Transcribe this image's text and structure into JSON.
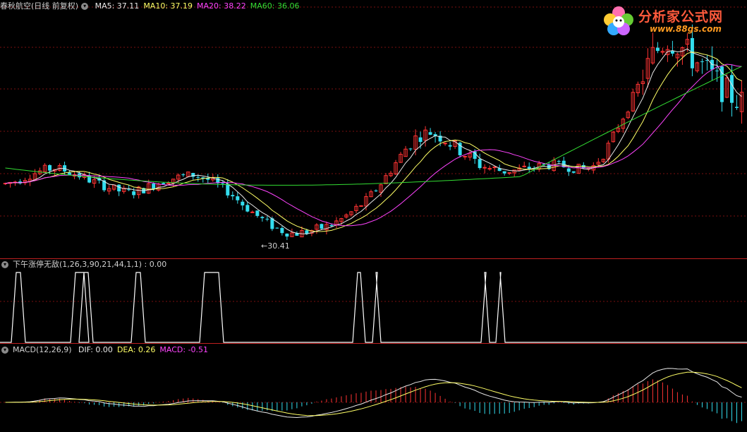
{
  "main_header": {
    "name": "春秋航空(日线 前复权)",
    "indicators": [
      {
        "text": "MA5: 37.11",
        "color": "#e8e8e8"
      },
      {
        "text": "MA10: 37.19",
        "color": "#ffff66"
      },
      {
        "text": "MA20: 38.22",
        "color": "#ff44ff"
      },
      {
        "text": "MA60: 36.06",
        "color": "#33dd33"
      }
    ]
  },
  "low_label": "←30.41",
  "indicator_header": {
    "text": "下午涨停无敌(1,26,3,90,21,44,1,1) : 0.00"
  },
  "macd_header": {
    "name": "MACD(12,26,9)",
    "values": [
      {
        "text": "DIF: 0.00",
        "color": "#e8e8e8"
      },
      {
        "text": "DEA: 0.26",
        "color": "#ffff66"
      },
      {
        "text": "MACD: -0.51",
        "color": "#ff44ff"
      }
    ]
  },
  "logo": {
    "title": "分析家公式网",
    "url": "www.88gs.com"
  },
  "colors": {
    "up": "#ff3333",
    "down": "#33ddee",
    "grid": "#7a1010",
    "separator": "#c02020",
    "ma5": "#e8e8e8",
    "ma10": "#ffff66",
    "ma20": "#ff44ff",
    "ma60": "#33dd33"
  },
  "chart_data": {
    "type": "line",
    "ma_close_trend": [
      35.6,
      35.9,
      36.4,
      36.8,
      37.0,
      36.7,
      36.3,
      35.8,
      35.4,
      35.0,
      34.8,
      35.1,
      35.6,
      36.0,
      36.2,
      36.4,
      36.1,
      35.5,
      34.8,
      33.8,
      32.9,
      32.1,
      31.5,
      31.2,
      31.3,
      31.6,
      31.9,
      32.5,
      33.3,
      34.2,
      35.5,
      37.0,
      38.6,
      39.8,
      40.2,
      39.7,
      38.9,
      38.1,
      37.3,
      36.9,
      36.7,
      36.8,
      37.0,
      37.2,
      37.3,
      37.1,
      36.9,
      37.0,
      38.3,
      40.5,
      42.6,
      45.0,
      47.2,
      48.4,
      47.9,
      46.8,
      45.8,
      44.6,
      43.5,
      42.8
    ],
    "indicator_signal_peaks": [
      1,
      1,
      1,
      1,
      1,
      1,
      1,
      1,
      1,
      1
    ],
    "macd": {
      "dif": 0.0,
      "dea": 0.26,
      "macd": -0.51
    }
  }
}
